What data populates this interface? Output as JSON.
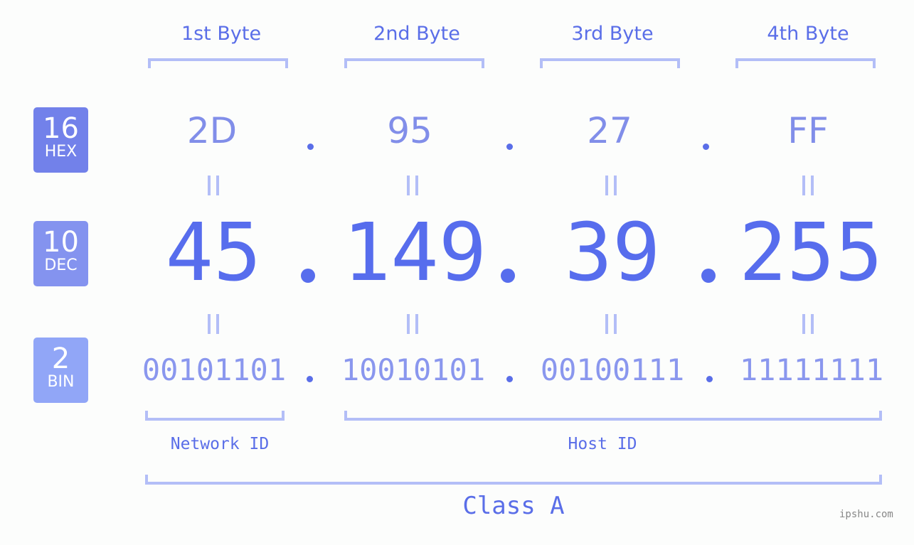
{
  "byte_headers": [
    "1st Byte",
    "2nd Byte",
    "3rd Byte",
    "4th Byte"
  ],
  "badges": [
    {
      "num": "16",
      "label": "HEX",
      "color": "#7281ea"
    },
    {
      "num": "10",
      "label": "DEC",
      "color": "#8493ef"
    },
    {
      "num": "2",
      "label": "BIN",
      "color": "#91a6f7"
    }
  ],
  "hex": [
    "2D",
    "95",
    "27",
    "FF"
  ],
  "dec": [
    "45",
    "149",
    "39",
    "255"
  ],
  "bin": [
    "00101101",
    "10010101",
    "00100111",
    "11111111"
  ],
  "network_label": "Network ID",
  "host_label": "Host ID",
  "class_label": "Class A",
  "watermark": "ipshu.com",
  "colors": {
    "accent": "#576ded",
    "bracket": "#b3bef7",
    "hex_text": "#818ee9",
    "bin_text": "#8a97ee"
  }
}
